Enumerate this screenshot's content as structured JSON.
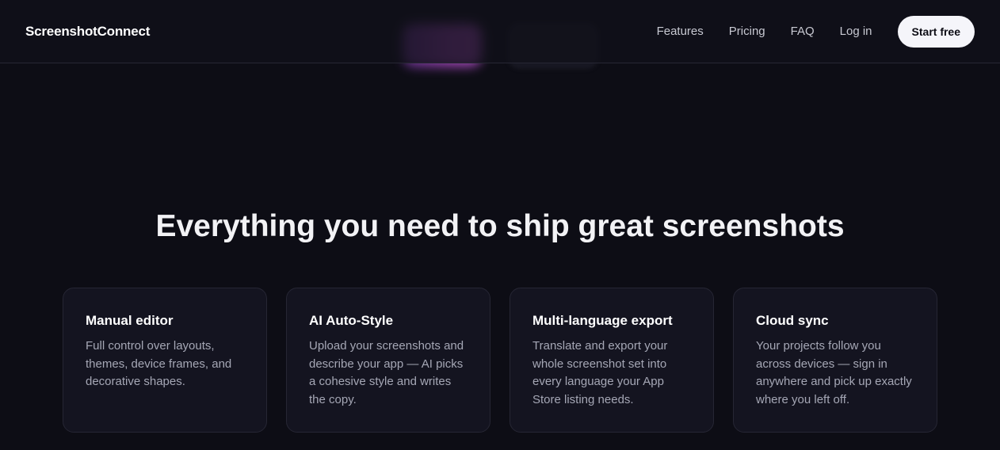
{
  "header": {
    "logo": "ScreenshotConnect",
    "nav": [
      {
        "label": "Features"
      },
      {
        "label": "Pricing"
      },
      {
        "label": "FAQ"
      },
      {
        "label": "Log in"
      }
    ],
    "cta_label": "Start free"
  },
  "features": {
    "title": "Everything you need to ship great screenshots",
    "cards": [
      {
        "title": "Manual editor",
        "desc": "Full control over layouts, themes, device frames, and decorative shapes."
      },
      {
        "title": "AI Auto-Style",
        "desc": "Upload your screenshots and describe your app — AI picks a cohesive style and writes the copy."
      },
      {
        "title": "Multi-language export",
        "desc": "Translate and export your whole screenshot set into every language your App Store listing needs."
      },
      {
        "title": "Cloud sync",
        "desc": "Your projects follow you across devices — sign in anywhere and pick up exactly where you left off."
      }
    ]
  },
  "colors": {
    "background": "#0d0d15",
    "card_background": "#141420",
    "accent_gradient_start": "#7a3aa6",
    "accent_gradient_end": "#c056d8",
    "cta_background": "#f5f5fa"
  }
}
